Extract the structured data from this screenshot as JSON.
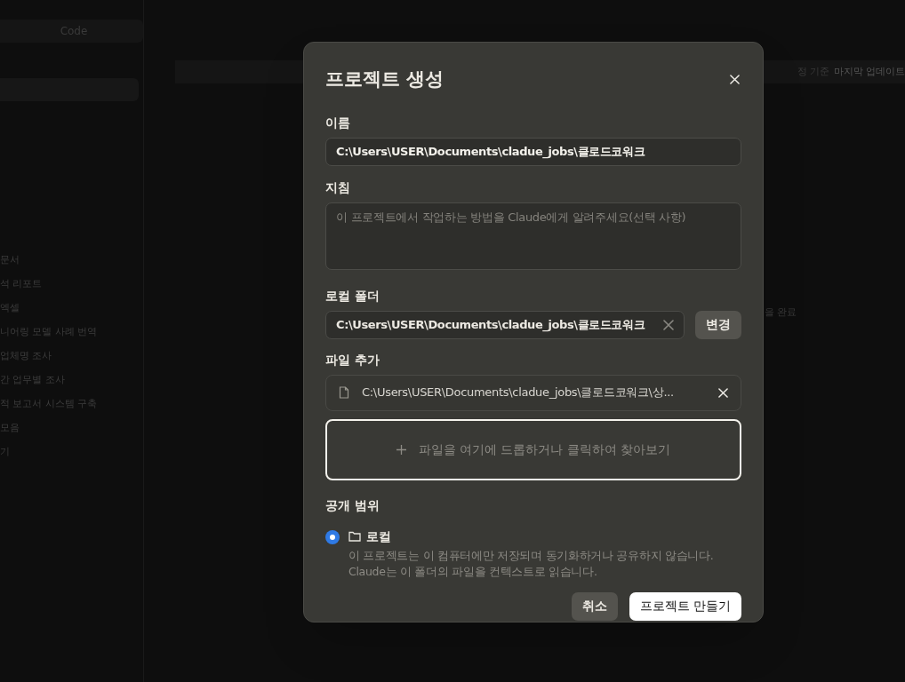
{
  "background": {
    "mode_tab": "Code",
    "sidebar_items": [
      "문서",
      "석 리포트",
      "엑셀",
      "니어링 모델 사례 번역",
      "업체명 조사",
      "간 업무별 조사",
      "적 보고서 시스템 구축",
      "모음",
      "기"
    ],
    "header_note": {
      "muted": "정 기준",
      "bold": "마지막 업데이트"
    },
    "side_note": "을 완료"
  },
  "dialog": {
    "title": "프로젝트 생성",
    "name": {
      "label": "이름",
      "value": "C:\\Users\\USER\\Documents\\cladue_jobs\\클로드코워크"
    },
    "instructions": {
      "label": "지침",
      "placeholder": "이 프로젝트에서 작업하는 방법을 Claude에게 알려주세요(선택 사항)"
    },
    "local_folder": {
      "label": "로컬 폴더",
      "value": "C:\\Users\\USER\\Documents\\cladue_jobs\\클로드코워크",
      "change_button": "변경"
    },
    "files": {
      "label": "파일 추가",
      "items": [
        "C:\\Users\\USER\\Documents\\cladue_jobs\\클로드코워크\\상..."
      ],
      "dropzone": "파일을 여기에 드롭하거나 클릭하여 찾아보기"
    },
    "visibility": {
      "label": "공개 범위",
      "options": [
        {
          "label": "로컬",
          "selected": true,
          "description": "이 프로젝트는 이 컴퓨터에만 저장되며 동기화하거나 공유하지 않습니다.\nClaude는 이 폴더의 파일을 컨텍스트로 읽습니다."
        }
      ]
    },
    "buttons": {
      "cancel": "취소",
      "create": "프로젝트 만들기"
    }
  }
}
